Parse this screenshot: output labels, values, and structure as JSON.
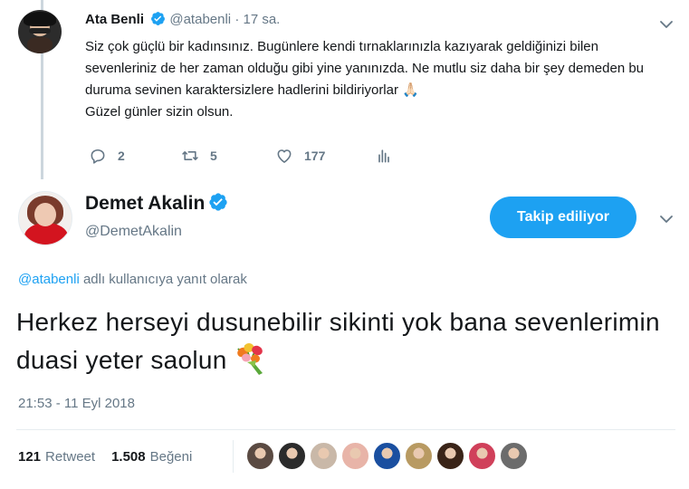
{
  "reply_tweet": {
    "name": "Ata Benli",
    "handle": "@atabenli",
    "dot": "·",
    "time": "17 sa.",
    "text": "Siz çok güçlü bir kadınsınız. Bugünlere kendi tırnaklarınızla kazıyarak geldiğinizi bilen sevenleriniz de her zaman olduğu gibi yine yanınızda. Ne mutlu siz daha bir şey demeden bu duruma sevinen karaktersizlere hadlerini bildiriyorlar",
    "text_end": "Güzel günler sizin olsun.",
    "emoji": "🙏🏻",
    "actions": {
      "replies": "2",
      "retweets": "5",
      "likes": "177"
    }
  },
  "main_tweet": {
    "name": "Demet Akalin",
    "handle": "@DemetAkalin",
    "follow_label": "Takip ediliyor",
    "reply_to_handle": "@atabenli",
    "reply_to_suffix": " adlı kullanıcıya yanıt olarak",
    "text": "Herkez herseyi dusunebilir sikinti yok bana sevenlerimin duasi yeter saolun",
    "timestamp": "21:53 - 11 Eyl 2018",
    "stats": {
      "retweets": "121",
      "retweets_label": "Retweet",
      "likes": "1.508",
      "likes_label": "Beğeni"
    },
    "liker_colors": [
      "#5a4a42",
      "#2b2b2b",
      "#c9b8a8",
      "#e8b4a8",
      "#1a4fa0",
      "#b89a62",
      "#3a2418",
      "#d0405a",
      "#6c6c6c"
    ]
  },
  "colors": {
    "accent": "#1da1f2",
    "muted": "#657786",
    "text": "#14171a"
  },
  "icons": [
    "verified-badge-icon",
    "chevron-down-icon",
    "reply-icon",
    "retweet-icon",
    "like-heart-icon",
    "analytics-icon",
    "praying-hands-emoji",
    "bouquet-emoji"
  ]
}
